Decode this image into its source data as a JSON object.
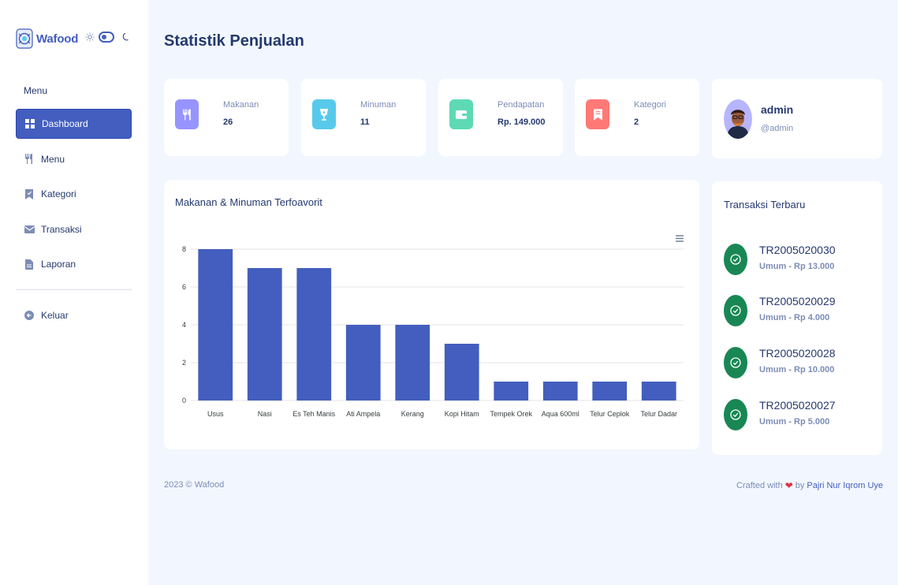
{
  "brand": {
    "name": "Wafood"
  },
  "sidebar": {
    "title": "Menu",
    "items": [
      {
        "label": "Dashboard",
        "icon": "grid-icon",
        "active": true
      },
      {
        "label": "Menu",
        "icon": "utensils-icon"
      },
      {
        "label": "Kategori",
        "icon": "bookmark-icon"
      },
      {
        "label": "Transaksi",
        "icon": "envelope-icon"
      },
      {
        "label": "Laporan",
        "icon": "file-icon"
      }
    ],
    "logout": {
      "label": "Keluar",
      "icon": "arrow-left-circle-icon"
    }
  },
  "page": {
    "title": "Statistik Penjualan"
  },
  "stats": [
    {
      "label": "Makanan",
      "value": "26",
      "icon": "utensils-icon",
      "color": "#9694ff"
    },
    {
      "label": "Minuman",
      "value": "11",
      "icon": "cup-icon",
      "color": "#57caeb"
    },
    {
      "label": "Pendapatan",
      "value": "Rp. 149.000",
      "icon": "wallet-icon",
      "color": "#5ddab4"
    },
    {
      "label": "Kategori",
      "value": "2",
      "icon": "bookmark-icon",
      "color": "#ff7976"
    }
  ],
  "profile": {
    "name": "admin",
    "username": "@admin"
  },
  "chart_card": {
    "title": "Makanan & Minuman Terfoavorit"
  },
  "chart_data": {
    "type": "bar",
    "categories": [
      "Usus",
      "Nasi",
      "Es Teh Manis",
      "Ati Ampela",
      "Kerang",
      "Kopi Hitam",
      "Tempek Orek",
      "Aqua 600ml",
      "Telur Ceplok",
      "Telur Dadar"
    ],
    "values": [
      8,
      7,
      7,
      4,
      4,
      3,
      1,
      1,
      1,
      1
    ],
    "ylim": [
      0,
      8
    ],
    "yticks": [
      0,
      2,
      4,
      6,
      8
    ],
    "grid": true,
    "bar_color": "#435ebe"
  },
  "transactions": {
    "title": "Transaksi Terbaru",
    "items": [
      {
        "id": "TR2005020030",
        "meta": "Umum - Rp 13.000"
      },
      {
        "id": "TR2005020029",
        "meta": "Umum - Rp 4.000"
      },
      {
        "id": "TR2005020028",
        "meta": "Umum - Rp 10.000"
      },
      {
        "id": "TR2005020027",
        "meta": "Umum - Rp 5.000"
      }
    ]
  },
  "footer": {
    "left": "2023 © Wafood",
    "crafted": "Crafted with",
    "by": "by",
    "author": "Pajri Nur Iqrom Uye"
  }
}
